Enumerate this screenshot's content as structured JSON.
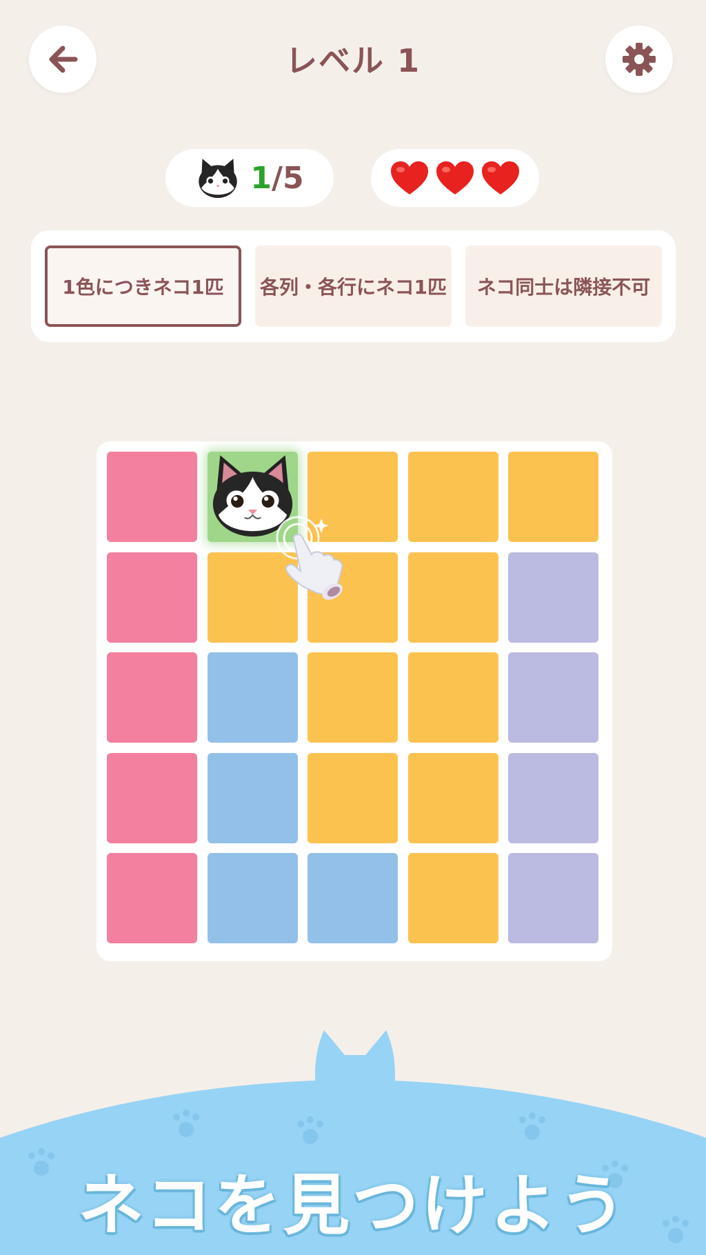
{
  "app": {
    "title": "レベル 1",
    "back_icon": "arrow-left-icon",
    "settings_icon": "gear-icon"
  },
  "status": {
    "found": "1",
    "total_text": "/5",
    "lives": 3,
    "heart_icon": "heart-icon"
  },
  "rules": [
    {
      "label": "1色につきネコ1匹",
      "active": true
    },
    {
      "label": "各列・各行にネコ1匹",
      "active": false
    },
    {
      "label": "ネコ同士は隣接不可",
      "active": false
    }
  ],
  "colors": {
    "accent": "#8a5456",
    "pink": "#f2809e",
    "yellow": "#fcc250",
    "blue": "#93c0e8",
    "purple": "#bbbae0",
    "green": "#9fd68a",
    "progress_current": "#2aa32c",
    "banner": "#97d3f5"
  },
  "board": {
    "size": 5,
    "rows": [
      [
        "pink",
        "green",
        "yellow",
        "yellow",
        "yellow"
      ],
      [
        "pink",
        "yellow",
        "yellow",
        "yellow",
        "purple"
      ],
      [
        "pink",
        "blue",
        "yellow",
        "yellow",
        "purple"
      ],
      [
        "pink",
        "blue",
        "yellow",
        "yellow",
        "purple"
      ],
      [
        "pink",
        "blue",
        "blue",
        "yellow",
        "purple"
      ]
    ],
    "cat_cell": [
      0,
      1
    ]
  },
  "banner": {
    "slogan": "ネコを見つけよう"
  }
}
